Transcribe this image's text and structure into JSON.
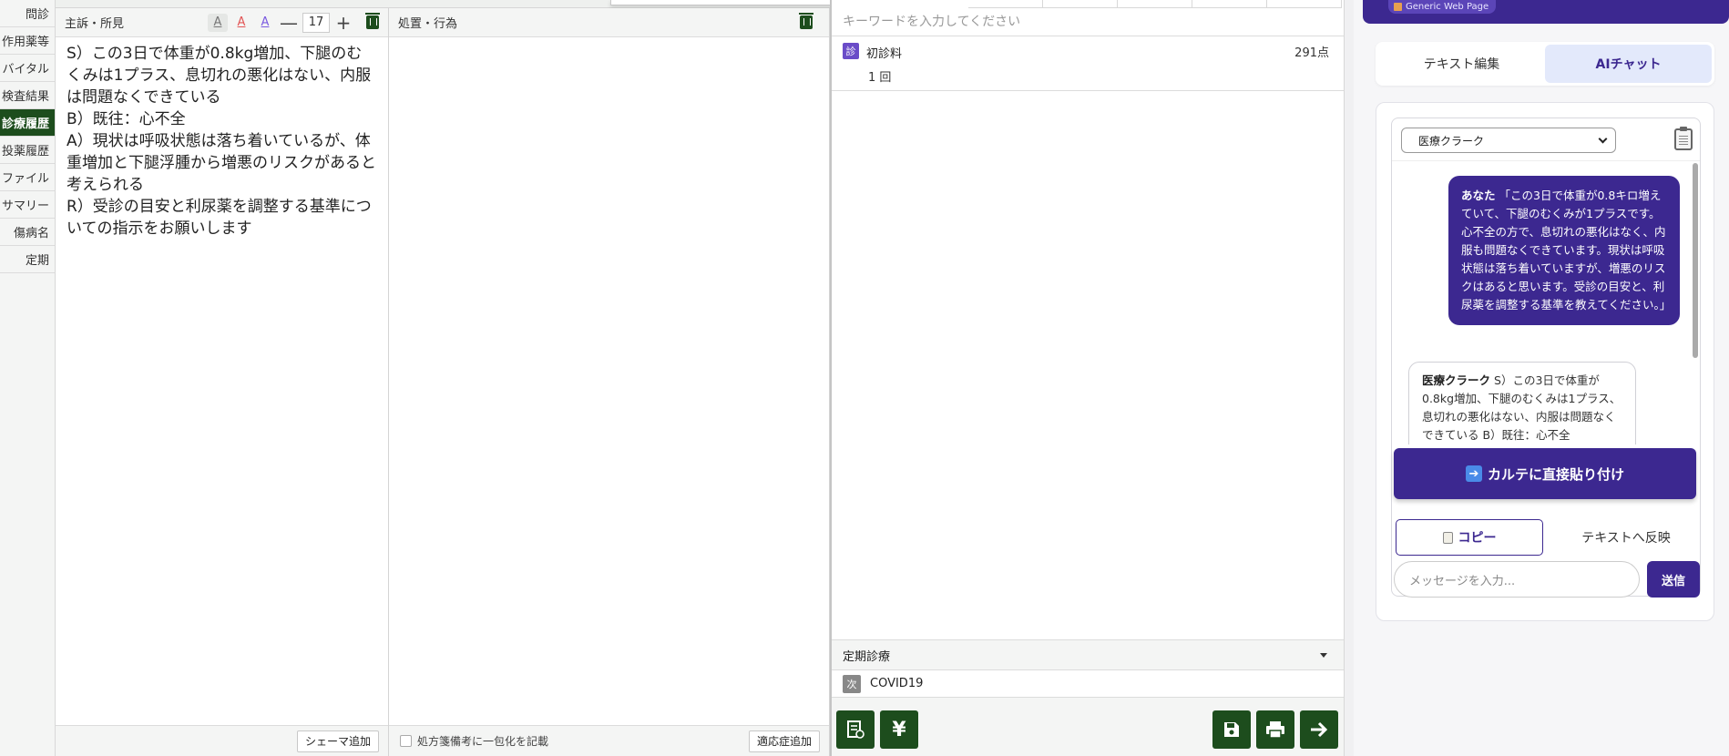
{
  "side_tabs": [
    "問診",
    "作用薬等",
    "バイタル",
    "検査結果",
    "診療履歴",
    "投薬履歴",
    "ファイル",
    "サマリー",
    "傷病名",
    "定期"
  ],
  "side_tab_active": "診療履歴",
  "soap": {
    "title": "主訴・所見",
    "font_size": "17",
    "tool_a": "A",
    "tool_minus": "—",
    "tool_plus": "+",
    "lines": [
      "S）この3日で体重が0.8kg増加、下腿のむくみは1プラス、息切れの悪化はない、内服は問題なくできている",
      "B）既往：心不全",
      "A）現状は呼吸状態は落ち着いているが、体重増加と下腿浮腫から増悪のリスクがあると考えられる",
      "R）受診の目安と利尿薬を調整する基準についての指示をお願いします"
    ],
    "schema_button": "シェーマ追加"
  },
  "treatment": {
    "title": "処置・行為",
    "checkbox_label": "処方箋備考に一包化を記載",
    "indication_button": "適応症追加"
  },
  "orders": {
    "search_placeholder": "キーワードを入力してください",
    "items": [
      {
        "badge": "診",
        "name": "初診料",
        "points": "291点",
        "qty": "1 回"
      }
    ],
    "teiki_title": "定期診療",
    "teiki_items": [
      {
        "badge": "次",
        "name": "COVID19"
      }
    ]
  },
  "ai": {
    "header_chip": "Generic Web Page",
    "tabs": [
      "テキスト編集",
      "AIチャット"
    ],
    "active_tab": "AIチャット",
    "role_select": "医療クラーク",
    "messages": [
      {
        "sender": "あなた",
        "text": "「この3日で体重が0.8キロ増えていて、下腿のむくみが1プラスです。心不全の方で、息切れの悪化はなく、内服も問題なくできています。現状は呼吸状態は落ち着いていますが、増悪のリスクはあると思います。受診の目安と、利尿薬を調整する基準を教えてください。」"
      },
      {
        "sender": "医療クラーク",
        "text": "S）この3日で体重が0.8kg増加、下腿のむくみは1プラス、息切れの悪化はない、内服は問題なくできている B）既往：心不全"
      }
    ],
    "paste_button": "カルテに直接貼り付け",
    "copy_button": "コピー",
    "reflect_button": "テキストへ反映",
    "message_placeholder": "メッセージを入力...",
    "send_button": "送信"
  },
  "colors": {
    "dark_green": "#1d4d1d",
    "ai_purple": "#3c2890",
    "order_badge": "#6a4cc8"
  }
}
